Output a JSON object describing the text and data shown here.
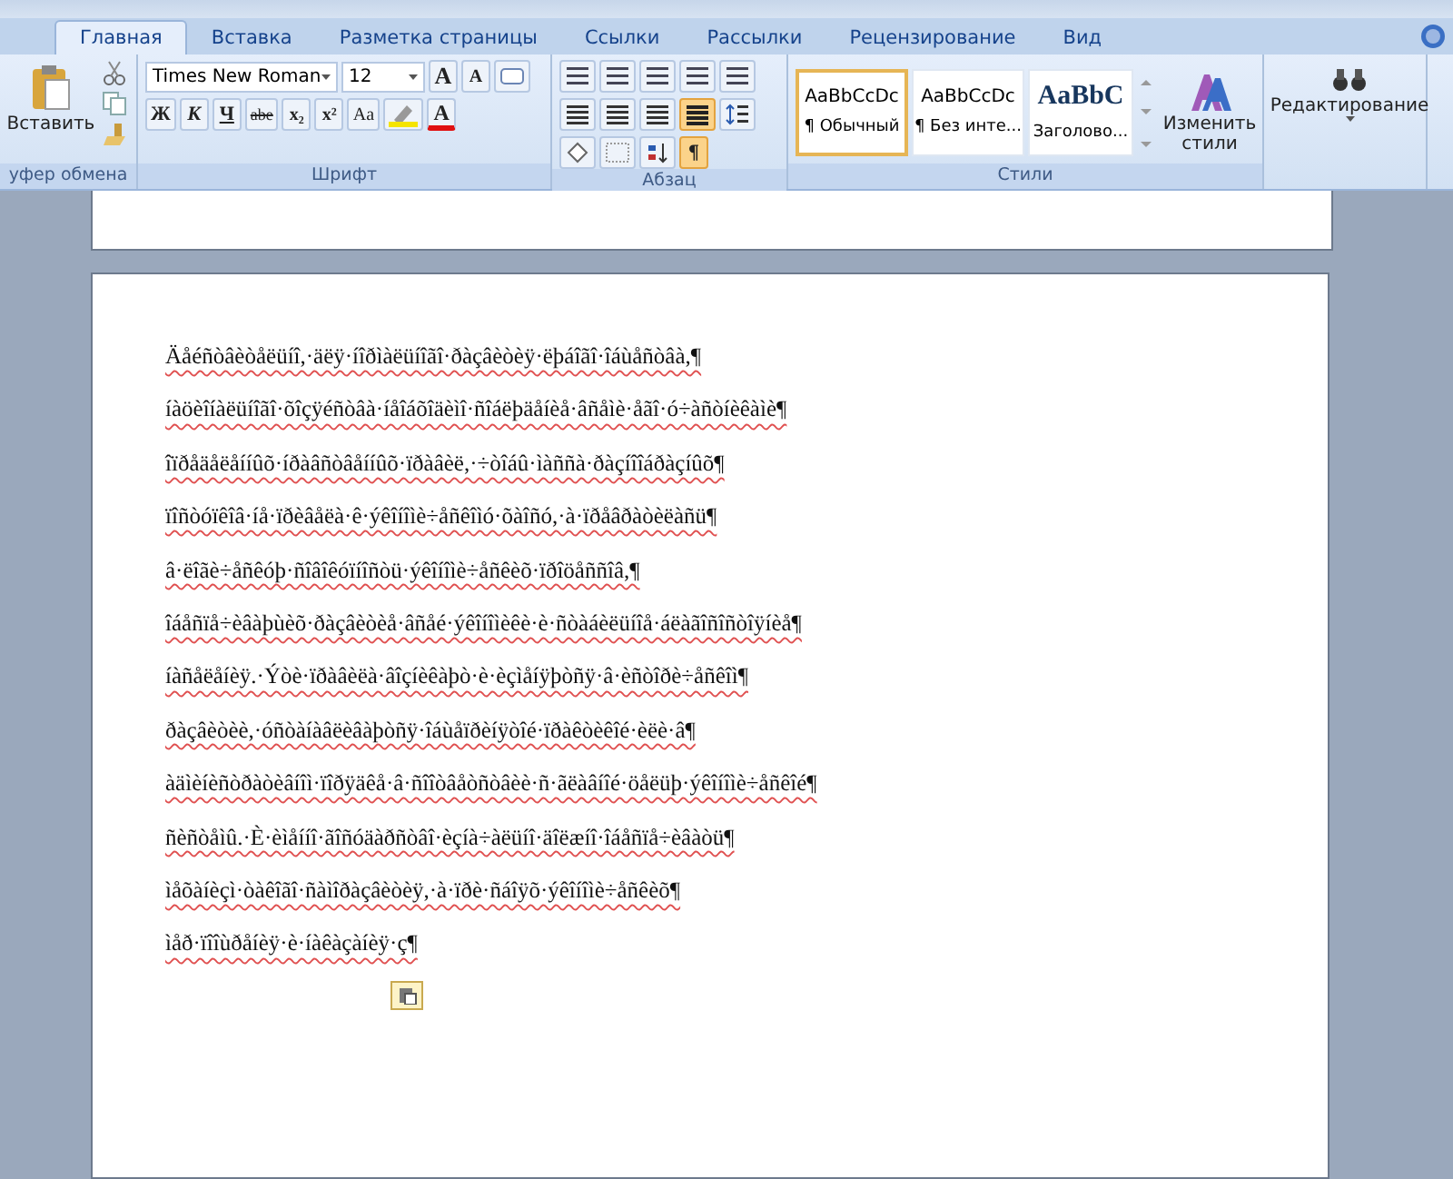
{
  "tabs": [
    {
      "label": "Главная",
      "selected": true
    },
    {
      "label": "Вставка",
      "selected": false
    },
    {
      "label": "Разметка страницы",
      "selected": false
    },
    {
      "label": "Ссылки",
      "selected": false
    },
    {
      "label": "Рассылки",
      "selected": false
    },
    {
      "label": "Рецензирование",
      "selected": false
    },
    {
      "label": "Вид",
      "selected": false
    }
  ],
  "clipboard": {
    "paste_label": "Вставить",
    "group_label": "уфер обмена"
  },
  "font": {
    "name": "Times New Roman",
    "size": "12",
    "bold_label": "Ж",
    "italic_label": "К",
    "underline_label": "Ч",
    "strike_label": "abe",
    "sub_label": "x₂",
    "sup_label": "x²",
    "case_label": "Aa",
    "grow_label": "A",
    "shrink_label": "A",
    "color_label": "A",
    "group_label": "Шрифт"
  },
  "paragraph": {
    "group_label": "Абзац",
    "show_marks_label": "¶",
    "justify_on": true,
    "show_marks_on": true
  },
  "styles": {
    "items": [
      {
        "sample": "AaBbCcDc",
        "name": "¶ Обычный",
        "selected": true,
        "kind": "normal"
      },
      {
        "sample": "AaBbCcDc",
        "name": "¶ Без инте...",
        "selected": false,
        "kind": "normal"
      },
      {
        "sample": "AaBbC",
        "name": "Заголово...",
        "selected": false,
        "kind": "heading"
      }
    ],
    "change_label": "Изменить стили",
    "group_label": "Стили"
  },
  "editing": {
    "label": "Редактирование"
  },
  "document": {
    "lines": [
      "Äåéñòâèòåëüíî,·äëÿ·íîðìàëüíîãî·ðàçâèòèÿ·ëþáîãî·îáùåñòâà,¶",
      "íàöèîíàëüíîãî·õîçÿéñòâà·íåîáõîäèìî·ñîáëþäåíèå·âñåìè·åãî·ó÷àñòíèêàìè¶",
      "îïðåäåëåííûõ·íðàâñòâåííûõ·ïðàâèë,·÷òîáû·ìàññà·ðàçíîîáðàçíûõ¶",
      "ïîñòóïêîâ·íå·ïðèâåëà·ê·ýêîíîìè÷åñêîìó·õàîñó,·à·ïðåâðàòèëàñü¶",
      "â·ëîãè÷åñêóþ·ñîâîêóïíîñòü·ýêîíîìè÷åñêèõ·ïðîöåññîâ,¶",
      "îáåñïå÷èâàþùèõ·ðàçâèòèå·âñåé·ýêîíîìèêè·è·ñòàáèëüíîå·áëàãîñîñòîÿíèå¶",
      "íàñåëåíèÿ.·Ýòè·ïðàâèëà·âîçíèêàþò·è·èçìåíÿþòñÿ·â·èñòîðè÷åñêîì¶",
      "ðàçâèòèè,·óñòàíàâëèâàþòñÿ·îáùåïðèíÿòîé·ïðàêòèêîé·èëè·â¶",
      "àäìèíèñòðàòèâíîì·ïîðÿäêå·â·ñîîòâåòñòâèè·ñ·ãëàâíîé·öåëüþ·ýêîíîìè÷åñêîé¶",
      "ñèñòåìû.·È·èìåííî·ãîñóäàðñòâî·èçíà÷àëüíî·äîëæíî·îáåñïå÷èâàòü¶",
      "ìåõàíèçì·òàêîãî·ñàìîðàçâèòèÿ,·à·ïðè·ñáîÿõ·ýêîíîìè÷åñêèõ¶",
      "ìåð·ïîîùðåíèÿ·è·íàêàçàíèÿ·ç¶"
    ],
    "paste_options": true
  }
}
